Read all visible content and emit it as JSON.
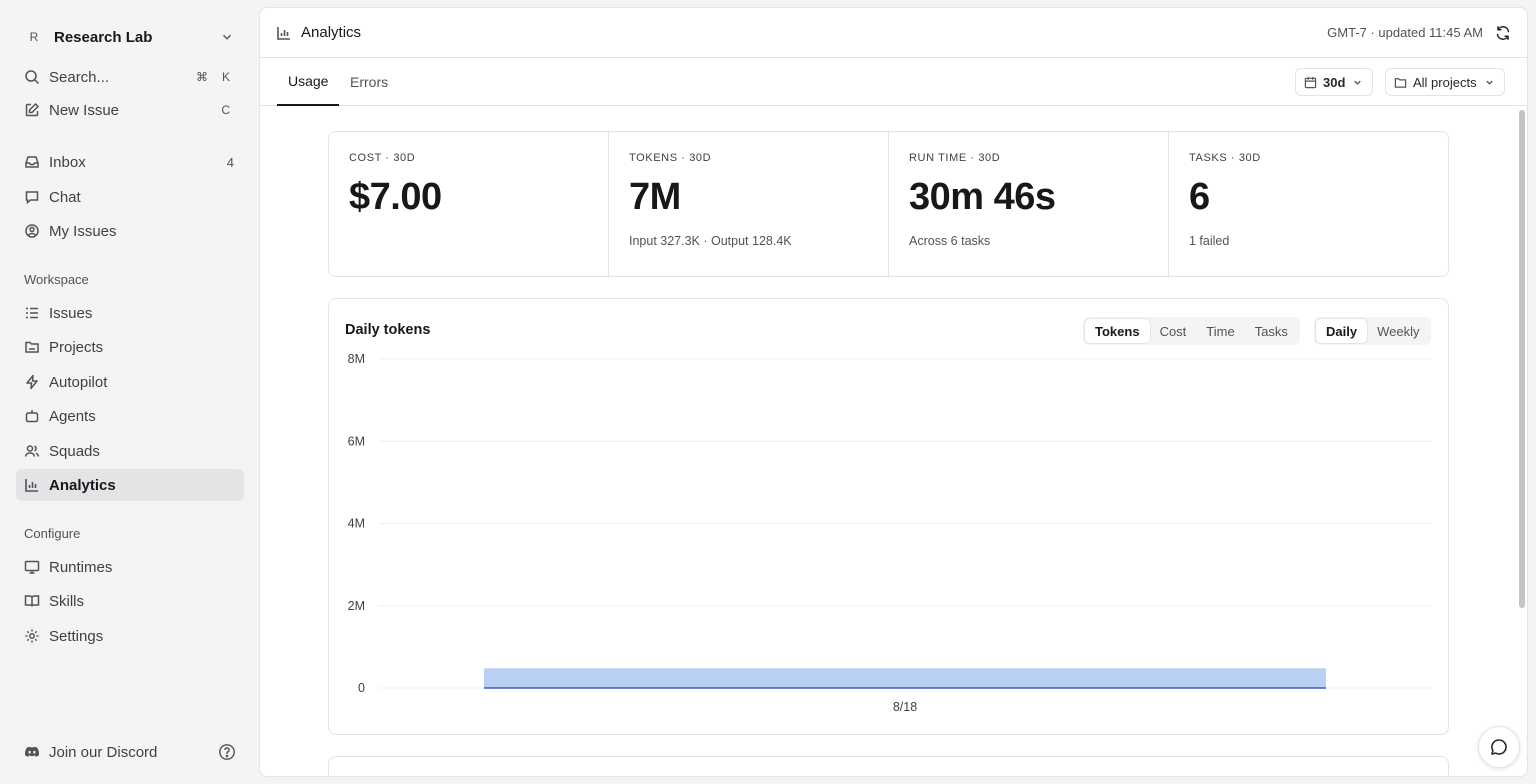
{
  "sidebar": {
    "workspace": {
      "avatar": "R",
      "name": "Research Lab"
    },
    "search": {
      "label": "Search...",
      "shortcut_mod": "⌘",
      "shortcut_key": "K"
    },
    "new_issue": {
      "label": "New Issue",
      "shortcut": "C"
    },
    "primary": [
      {
        "label": "Inbox",
        "count": "4",
        "icon": "inbox-icon"
      },
      {
        "label": "Chat",
        "icon": "chat-icon"
      },
      {
        "label": "My Issues",
        "icon": "user-circle-icon"
      }
    ],
    "workspace_section": {
      "label": "Workspace",
      "items": [
        {
          "label": "Issues",
          "icon": "list-icon"
        },
        {
          "label": "Projects",
          "icon": "folder-icon"
        },
        {
          "label": "Autopilot",
          "icon": "bolt-icon"
        },
        {
          "label": "Agents",
          "icon": "bot-icon"
        },
        {
          "label": "Squads",
          "icon": "users-icon"
        },
        {
          "label": "Analytics",
          "icon": "bar-chart-icon",
          "active": true
        }
      ]
    },
    "configure_section": {
      "label": "Configure",
      "items": [
        {
          "label": "Runtimes",
          "icon": "monitor-icon"
        },
        {
          "label": "Skills",
          "icon": "book-icon"
        },
        {
          "label": "Settings",
          "icon": "gear-icon"
        }
      ]
    },
    "discord": {
      "label": "Join our Discord"
    }
  },
  "header": {
    "title": "Analytics",
    "updated": "GMT-7 · updated 11:45 AM"
  },
  "tabs": [
    {
      "label": "Usage",
      "active": true
    },
    {
      "label": "Errors"
    }
  ],
  "filters": {
    "range": "30d",
    "projects": "All projects"
  },
  "stats": [
    {
      "label": "COST · 30D",
      "value": "$7.00",
      "sub": ""
    },
    {
      "label": "TOKENS · 30D",
      "value": "7M",
      "sub": "Input 327.3K · Output 128.4K"
    },
    {
      "label": "RUN TIME · 30D",
      "value": "30m 46s",
      "sub": "Across 6 tasks"
    },
    {
      "label": "TASKS · 30D",
      "value": "6",
      "sub": "1 failed"
    }
  ],
  "chart": {
    "title": "Daily tokens",
    "metric_options": [
      "Tokens",
      "Cost",
      "Time",
      "Tasks"
    ],
    "metric_selected": "Tokens",
    "period_options": [
      "Daily",
      "Weekly"
    ],
    "period_selected": "Daily"
  },
  "chart_data": {
    "type": "area",
    "title": "Daily tokens",
    "y_ticks": [
      "0",
      "2M",
      "4M",
      "6M",
      "8M"
    ],
    "ylim": [
      0,
      8000000
    ],
    "x": [
      "8/18"
    ],
    "series": [
      {
        "values": [
          480000
        ]
      }
    ],
    "grid": true,
    "fill_color": "#b9cff3",
    "line_color": "#3b5fc4"
  }
}
